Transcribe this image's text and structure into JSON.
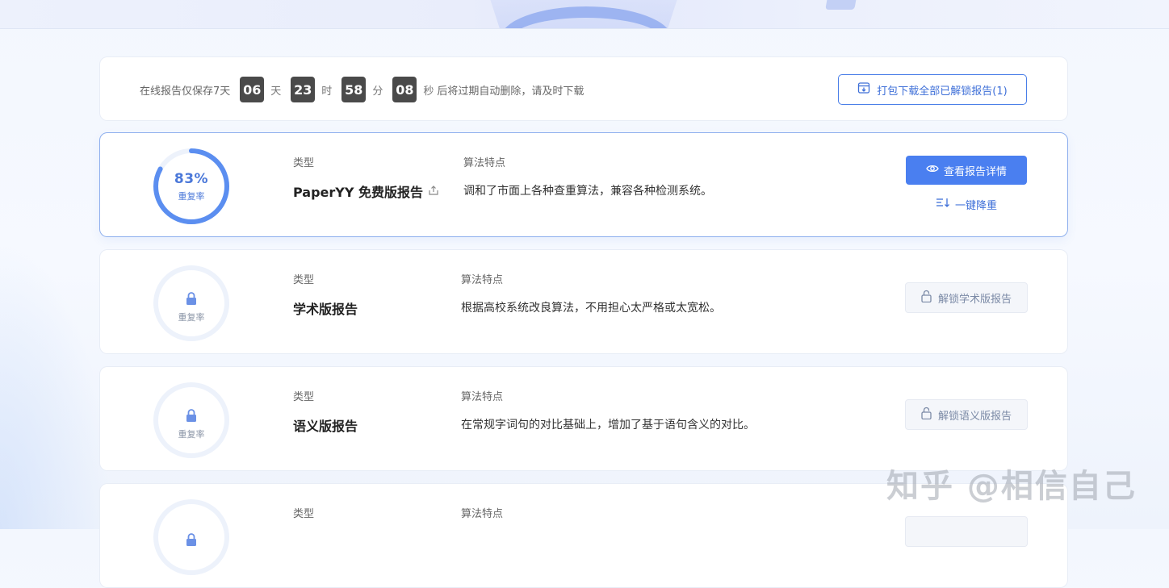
{
  "notice": {
    "lead_text": "在线报告仅保存7天",
    "timer": [
      {
        "value": "06",
        "unit": "天"
      },
      {
        "value": "23",
        "unit": "时"
      },
      {
        "value": "58",
        "unit": "分"
      },
      {
        "value": "08",
        "unit": "秒"
      }
    ],
    "tail_text": "后将过期自动删除，请及时下载",
    "download_button": "打包下载全部已解锁报告(1)"
  },
  "reports": [
    {
      "rate": "83%",
      "rate_fraction": 0.83,
      "rate_label": "重复率",
      "type_label": "类型",
      "type": "PaperYY 免费版报告",
      "algo_label": "算法特点",
      "algo": "调和了市面上各种查重算法，兼容各种检测系统。",
      "primary_action": "查看报告详情",
      "secondary_action": "一键降重",
      "locked": false
    },
    {
      "rate_label": "重复率",
      "type_label": "类型",
      "type": "学术版报告",
      "algo_label": "算法特点",
      "algo": "根据高校系统改良算法，不用担心太严格或太宽松。",
      "unlock_action": "解锁学术版报告",
      "locked": true
    },
    {
      "rate_label": "重复率",
      "type_label": "类型",
      "type": "语义版报告",
      "algo_label": "算法特点",
      "algo": "在常规字词句的对比基础上，增加了基于语句含义的对比。",
      "unlock_action": "解锁语义版报告",
      "locked": true
    },
    {
      "type_label": "类型",
      "algo_label": "算法特点",
      "locked": true
    }
  ],
  "watermark": "知乎 @相信自己",
  "colors": {
    "accent": "#4a7ff0",
    "gauge_track": "#edf2fb",
    "gauge_fill": "#5b8ef0"
  }
}
